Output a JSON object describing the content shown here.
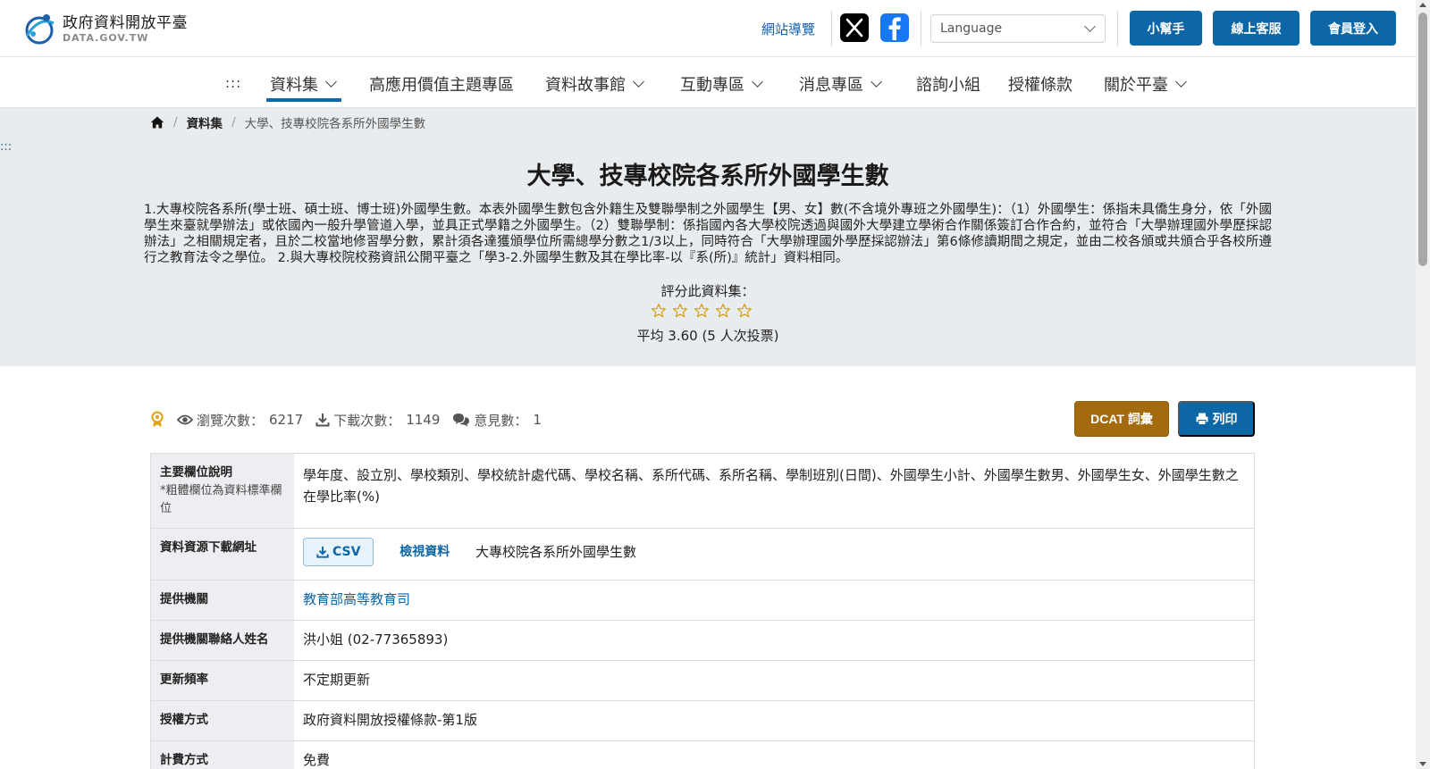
{
  "header": {
    "logo_title": "政府資料開放平臺",
    "logo_sub": "DATA.GOV.TW",
    "sitemap": "網站導覽",
    "language_placeholder": "Language",
    "helper_button": "小幫手",
    "support_button": "線上客服",
    "login_button": "會員登入"
  },
  "nav": {
    "accesskey": ":::",
    "items": [
      {
        "label": "資料集"
      },
      {
        "label": "高應用價值主題專區"
      },
      {
        "label": "資料故事館"
      },
      {
        "label": "互動專區"
      },
      {
        "label": "消息專區"
      },
      {
        "label": "諮詢小組"
      },
      {
        "label": "授權條款"
      },
      {
        "label": "關於平臺"
      }
    ]
  },
  "hero": {
    "accesskey": ":::",
    "breadcrumb": {
      "dataset": "資料集",
      "current": "大學、技專校院各系所外國學生數"
    },
    "title": "大學、技專校院各系所外國學生數",
    "description": "1.大專校院各系所(學士班、碩士班、博士班)外國學生數。本表外國學生數包含外籍生及雙聯學制之外國學生【男、女】數(不含境外專班之外國學生)：（1）外國學生：係指未具僑生身分，依「外國學生來臺就學辦法」或依國內一般升學管道入學，並具正式學籍之外國學生。（2）雙聯學制：係指國內各大學校院透過與國外大學建立學術合作關係簽訂合作合約，並符合「大學辦理國外學歷採認辦法」之相關規定者，且於二校當地修習學分數，累計須各達獲頒學位所需總學分數之1/3以上，同時符合「大學辦理國外學歷採認辦法」第6條修讀期間之規定，並由二校各頒或共頒合乎各校所遵行之教育法令之學位。 2.與大專校院校務資訊公開平臺之「學3-2.外國學生數及其在學比率-以『系(所)』統計」資料相同。",
    "rate_label": "評分此資料集：",
    "rating_avg": 3.6,
    "rate_avg_text": "平均 3.60 (5 人次投票)"
  },
  "stats": {
    "views_label": "瀏覽次數：",
    "views": "6217",
    "downloads_label": "下載次數：",
    "downloads": "1149",
    "comments_label": "意見數：",
    "comments": "1",
    "dcat_button": "DCAT 詞彙",
    "print_button": "列印"
  },
  "table": {
    "fields_label": "主要欄位說明",
    "fields_note": "*粗體欄位為資料標準欄位",
    "fields_value": "學年度、設立別、學校類別、學校統計處代碼、學校名稱、系所代碼、系所名稱、學制班別(日間)、外國學生小計、外國學生數男、外國學生女、外國學生數之在學比率(%)",
    "download_label": "資料資源下載網址",
    "csv_button": "CSV",
    "view_link": "檢視資料",
    "resource_name": "大專校院各系所外國學生數",
    "provider_label": "提供機關",
    "provider_value": "教育部高等教育司",
    "contact_label": "提供機關聯絡人姓名",
    "contact_value": "洪小姐 (02-77365893)",
    "frequency_label": "更新頻率",
    "frequency_value": "不定期更新",
    "license_label": "授權方式",
    "license_value": "政府資料開放授權條款-第1版",
    "fee_label": "計費方式",
    "fee_value": "免費"
  },
  "colors": {
    "primary": "#0d66a6",
    "dcat": "#a46b0e",
    "hero_bg": "#e9ecef",
    "star_outline": "#d4a017"
  }
}
